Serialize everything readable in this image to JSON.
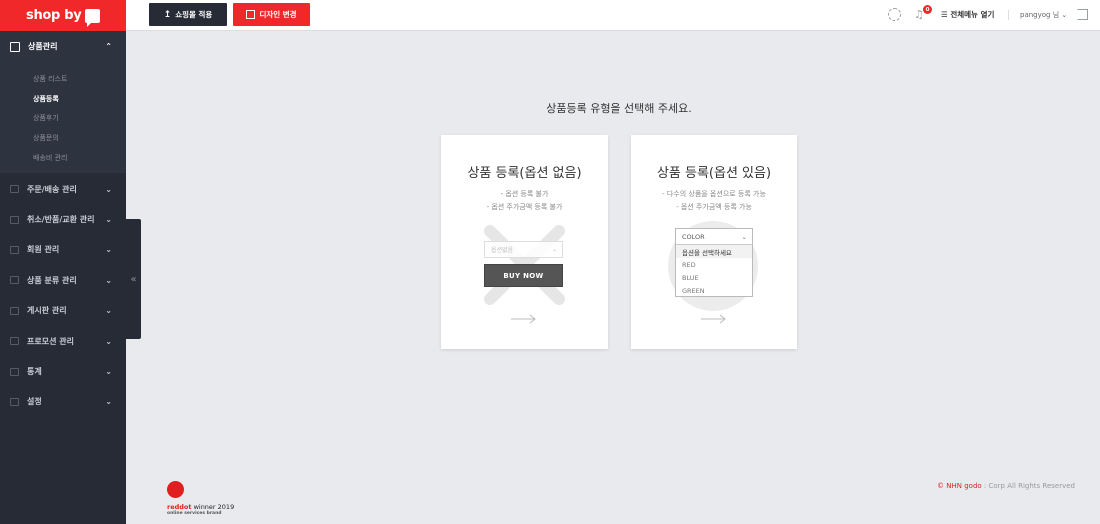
{
  "logo": {
    "text": "shop by"
  },
  "sidebar": {
    "open_menu": {
      "label": "상품관리",
      "items": [
        {
          "label": "상품 리스트",
          "active": false
        },
        {
          "label": "상품등록",
          "active": true
        },
        {
          "label": "상품후기",
          "active": false
        },
        {
          "label": "상품문의",
          "active": false
        },
        {
          "label": "배송비 관리",
          "active": false
        }
      ]
    },
    "items": [
      {
        "label": "주문/배송 관리"
      },
      {
        "label": "취소/반품/교환 관리"
      },
      {
        "label": "회원 관리"
      },
      {
        "label": "상품 분류 관리"
      },
      {
        "label": "게시판 관리"
      },
      {
        "label": "프로모션 관리"
      },
      {
        "label": "통계"
      },
      {
        "label": "설정"
      }
    ],
    "collapse_label": "«"
  },
  "topbar": {
    "apply_label": "쇼핑몰 적용",
    "design_label": "디자인 변경",
    "notification_count": "0",
    "all_menu_label": "전체메뉴 열기",
    "user_label": "pangyog 님"
  },
  "main": {
    "title": "상품등록 유형을 선택해 주세요.",
    "cards": [
      {
        "title": "상품 등록(옵션 없음)",
        "desc1": "- 옵션 등록 불가",
        "desc2": "- 옵션 주가금액 등록 불가",
        "select_placeholder": "옵션없음",
        "button_label": "BUY NOW"
      },
      {
        "title": "상품 등록(옵션 있음)",
        "desc1": "- 다수의 상품을 옵션으로 등록 가능",
        "desc2": "- 옵션 주가금액 등록 가능",
        "dropdown_head": "COLOR",
        "options": [
          "옵션을 선택하세요",
          "RED",
          "BLUE",
          "GREEN"
        ]
      }
    ]
  },
  "footer": {
    "award_brand": "reddot",
    "award_text": " winner 2019",
    "award_sub": "online services brand",
    "copyright_brand": "© NHN godo",
    "copyright_text": ": Corp All Rights Reserved"
  },
  "colors": {
    "brand": "#f0282a",
    "sidebar": "#272b36"
  }
}
